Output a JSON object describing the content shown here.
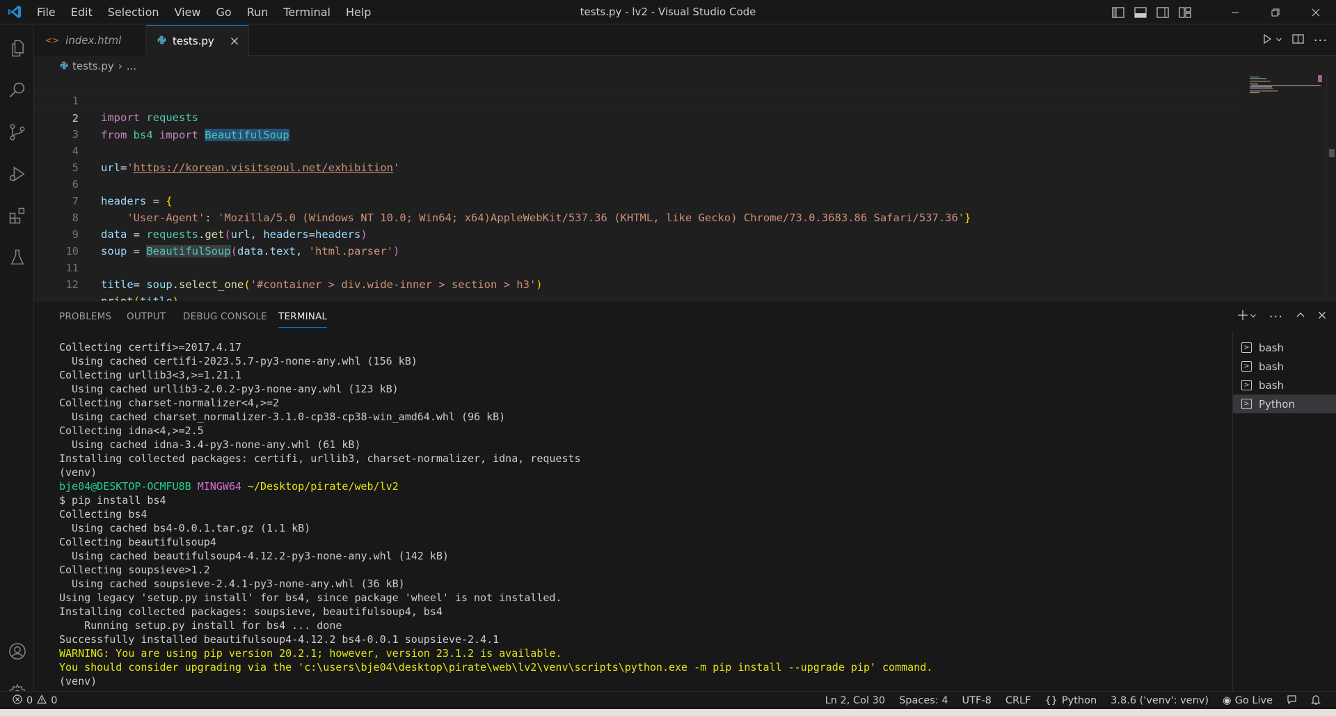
{
  "window": {
    "title": "tests.py - lv2 - Visual Studio Code"
  },
  "menu": [
    "File",
    "Edit",
    "Selection",
    "View",
    "Go",
    "Run",
    "Terminal",
    "Help"
  ],
  "tabs": [
    {
      "label": "index.html",
      "icon": "html-file-icon"
    },
    {
      "label": "tests.py",
      "icon": "python-file-icon"
    }
  ],
  "breadcrumb": {
    "file": "tests.py",
    "sep": "›",
    "rest": "..."
  },
  "editor": {
    "line_numbers": [
      "1",
      "2",
      "3",
      "4",
      "5",
      "6",
      "7",
      "8",
      "9",
      "10",
      "11",
      "12"
    ],
    "l1": {
      "a": "import",
      "b": " requests"
    },
    "l2": {
      "a": "from",
      "b": " bs4 ",
      "c": "import",
      "d": " ",
      "e": "BeautifulSoup"
    },
    "l4": {
      "a": "url",
      "b": "=",
      "c": "'",
      "d": "https://korean.visitseoul.net/exhibition",
      "e": "'"
    },
    "l6": {
      "a": "headers",
      "b": " = ",
      "c": "{"
    },
    "l7": {
      "a": "    'User-Agent'",
      "b": ": ",
      "c": "'Mozilla/5.0 (Windows NT 10.0; Win64; x64)AppleWebKit/537.36 (KHTML, like Gecko) Chrome/73.0.3683.86 Safari/537.36'",
      "d": "}"
    },
    "l8": {
      "a": "data",
      "b": " = ",
      "c": "requests",
      "d": ".",
      "e": "get",
      "f": "(",
      "g": "url",
      "h": ", ",
      "i": "headers",
      "j": "=",
      "k": "headers",
      "l": ")"
    },
    "l9": {
      "a": "soup",
      "b": " = ",
      "c": "BeautifulSoup",
      "d": "(",
      "e": "data",
      "f": ".",
      "g": "text",
      "h": ", ",
      "i": "'html.parser'",
      "j": ")"
    },
    "l11": {
      "a": "title",
      "b": "= ",
      "c": "soup",
      "d": ".",
      "e": "select_one",
      "f": "(",
      "g": "'#container > div.wide-inner > section > h3'",
      "h": ")"
    },
    "l12": {
      "a": "print",
      "b": "(",
      "c": "title",
      "d": ")"
    }
  },
  "panel": {
    "tabs": [
      "PROBLEMS",
      "OUTPUT",
      "DEBUG CONSOLE",
      "TERMINAL"
    ],
    "terminal_lines": {
      "t1": "Collecting certifi>=2017.4.17",
      "t2": "  Using cached certifi-2023.5.7-py3-none-any.whl (156 kB)",
      "t3": "Collecting urllib3<3,>=1.21.1",
      "t4": "  Using cached urllib3-2.0.2-py3-none-any.whl (123 kB)",
      "t5": "Collecting charset-normalizer<4,>=2",
      "t6": "  Using cached charset_normalizer-3.1.0-cp38-cp38-win_amd64.whl (96 kB)",
      "t7": "Collecting idna<4,>=2.5",
      "t8": "  Using cached idna-3.4-py3-none-any.whl (61 kB)",
      "t9": "Installing collected packages: certifi, urllib3, charset-normalizer, idna, requests",
      "t10": "(venv)",
      "t11_user": "bje04@DESKTOP-OCMFU8B",
      "t11_mingw": "MINGW64",
      "t11_path": "~/Desktop/pirate/web/lv2",
      "t12": "$ pip install bs4",
      "t13": "Collecting bs4",
      "t14": "  Using cached bs4-0.0.1.tar.gz (1.1 kB)",
      "t15": "Collecting beautifulsoup4",
      "t16": "  Using cached beautifulsoup4-4.12.2-py3-none-any.whl (142 kB)",
      "t17": "Collecting soupsieve>1.2",
      "t18": "  Using cached soupsieve-2.4.1-py3-none-any.whl (36 kB)",
      "t19": "Using legacy 'setup.py install' for bs4, since package 'wheel' is not installed.",
      "t20": "Installing collected packages: soupsieve, beautifulsoup4, bs4",
      "t21": "    Running setup.py install for bs4 ... done",
      "t22": "Successfully installed beautifulsoup4-4.12.2 bs4-0.0.1 soupsieve-2.4.1",
      "t23": "WARNING: You are using pip version 20.2.1; however, version 23.1.2 is available.",
      "t24": "You should consider upgrading via the 'c:\\users\\bje04\\desktop\\pirate\\web\\lv2\\venv\\scripts\\python.exe -m pip install --upgrade pip' command.",
      "t25": "(venv)"
    },
    "terminals": [
      "bash",
      "bash",
      "bash",
      "Python"
    ]
  },
  "status": {
    "errors": "0",
    "warnings": "0",
    "position": "Ln 2, Col 30",
    "spaces": "Spaces: 4",
    "encoding": "UTF-8",
    "eol": "CRLF",
    "language": "Python",
    "interpreter": "3.8.6 ('venv': venv)",
    "golive": "Go Live"
  },
  "colors": {
    "accent": "#0078d4",
    "python_icon": "#519aba",
    "html_icon": "#e37933"
  }
}
